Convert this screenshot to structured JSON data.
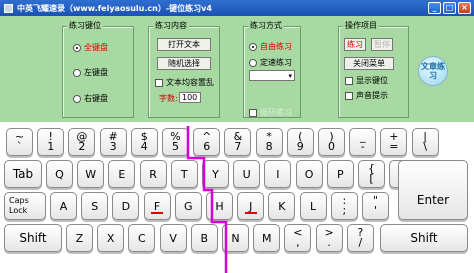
{
  "window": {
    "title": "中英飞耀速录（www.feiyaosulu.cn）-键位练习v4",
    "min": "_",
    "max": "□",
    "close": "×"
  },
  "groups": {
    "keys_practice": {
      "title": "练习键位",
      "options": [
        "全键盘",
        "左键盘",
        "右键盘"
      ]
    },
    "content": {
      "title": "练习内容",
      "open_text": "打开文本",
      "random": "随机选择",
      "loop_label": "文本均容置乱",
      "count_label": "字数:",
      "count_value": "100"
    },
    "mode": {
      "title": "练习方式",
      "free": "自由练习",
      "timed": "定速练习",
      "repeat": "循环练习"
    },
    "ops": {
      "title": "操作项目",
      "practice": "练习",
      "pause": "暂停",
      "close_menu": "关闭菜单",
      "show_keys": "显示键位",
      "sound": "声音提示"
    }
  },
  "logo_text": "文章练习",
  "keyboard": {
    "row1": [
      {
        "up": "~",
        "lo": "`"
      },
      {
        "up": "!",
        "lo": "1"
      },
      {
        "up": "@",
        "lo": "2"
      },
      {
        "up": "#",
        "lo": "3"
      },
      {
        "up": "$",
        "lo": "4"
      },
      {
        "up": "%",
        "lo": "5"
      },
      {
        "up": "^",
        "lo": "6"
      },
      {
        "up": "&",
        "lo": "7"
      },
      {
        "up": "*",
        "lo": "8"
      },
      {
        "up": "(",
        "lo": "9"
      },
      {
        "up": ")",
        "lo": "0"
      },
      {
        "up": "_",
        "lo": "-"
      },
      {
        "up": "+",
        "lo": "="
      },
      {
        "up": "|",
        "lo": "\\"
      }
    ],
    "row2_tab": "Tab",
    "row2": [
      {
        "k": "Q"
      },
      {
        "k": "W"
      },
      {
        "k": "E"
      },
      {
        "k": "R"
      },
      {
        "k": "T"
      },
      {
        "k": "Y"
      },
      {
        "k": "U"
      },
      {
        "k": "I"
      },
      {
        "k": "O"
      },
      {
        "k": "P"
      },
      {
        "up": "{",
        "lo": "["
      },
      {
        "up": "}",
        "lo": "]"
      }
    ],
    "caps_line1": "Caps",
    "caps_line2": "Lock",
    "row3": [
      {
        "k": "A"
      },
      {
        "k": "S"
      },
      {
        "k": "D"
      },
      {
        "k": "F"
      },
      {
        "k": "G"
      },
      {
        "k": "H"
      },
      {
        "k": "J"
      },
      {
        "k": "K"
      },
      {
        "k": "L"
      },
      {
        "up": ":",
        "lo": ";"
      },
      {
        "up": "\"",
        "lo": "'"
      }
    ],
    "enter": "Enter",
    "shift_left": "Shift",
    "row4": [
      {
        "k": "Z"
      },
      {
        "k": "X"
      },
      {
        "k": "C"
      },
      {
        "k": "V"
      },
      {
        "k": "B"
      },
      {
        "k": "N"
      },
      {
        "k": "M"
      },
      {
        "up": "<",
        "lo": ","
      },
      {
        "up": ">",
        "lo": "."
      },
      {
        "up": "?",
        "lo": "/"
      }
    ],
    "shift_right": "Shift"
  },
  "colors": {
    "panel": "#a8d9a2",
    "divider": "#d800d8",
    "accent_red": "#e00000"
  }
}
